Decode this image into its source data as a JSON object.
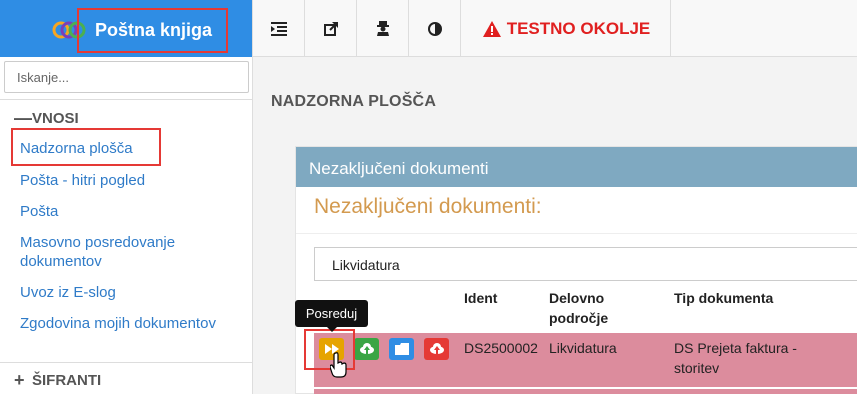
{
  "app": {
    "brand": "Poštna knjiga"
  },
  "sidebar": {
    "search_placeholder": "Iskanje...",
    "sections": [
      {
        "symbol": "—",
        "label": "VNOSI"
      },
      {
        "symbol": "+",
        "label": "ŠIFRANTI"
      }
    ],
    "items": [
      {
        "label": "Nadzorna plošča"
      },
      {
        "label": "Pošta - hitri pogled"
      },
      {
        "label": "Pošta"
      },
      {
        "label": "Masovno posredovanje dokumentov"
      },
      {
        "label": "Uvoz iz E-slog"
      },
      {
        "label": "Zgodovina mojih dokumentov"
      }
    ]
  },
  "topbar": {
    "warning": "TESTNO OKOLJE"
  },
  "main": {
    "page_title": "NADZORNA PLOŠČA",
    "panel_title": "Nezaključeni dokumenti",
    "panel_subtitle": "Nezaključeni dokumenti:",
    "filter_value": "Likvidatura",
    "columns": {
      "ident": "Ident",
      "area": "Delovno področje",
      "type": "Tip dokumenta"
    },
    "rows": [
      {
        "ident": "DS2500002",
        "area": "Likvidatura",
        "type": "DS Prejeta faktura - storitev"
      }
    ],
    "tooltip": "Posreduj"
  },
  "colors": {
    "brand": "#2f8de4",
    "warning": "#e02020",
    "row": "#dc8c9d",
    "panel_head": "#7fa9c1",
    "subtitle": "#d39a4f"
  }
}
